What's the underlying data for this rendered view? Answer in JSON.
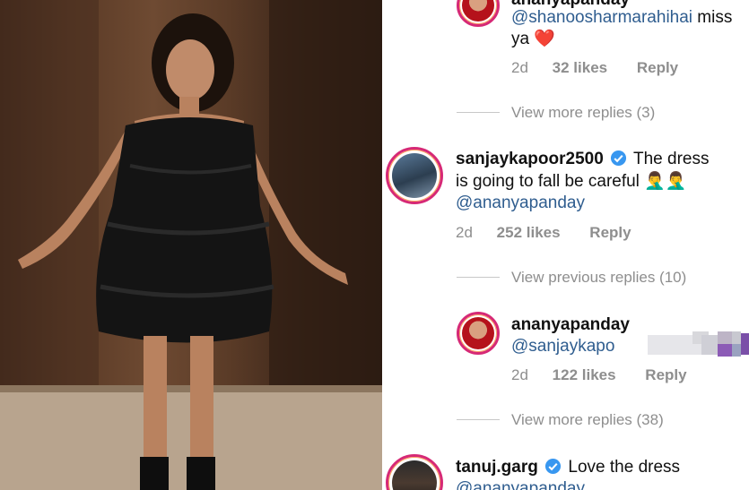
{
  "photo": {
    "alt_name": "woman-in-black-ruffle-dress-photo"
  },
  "comments": [
    {
      "username": "ananyapanday",
      "text_mention": "@shanoosharmarahihai",
      "text_rest": " miss",
      "text_line2": "ya",
      "emoji": "❤️",
      "age": "2d",
      "likes": "32 likes",
      "reply": "Reply"
    },
    {
      "username": "sanjaykapoor2500",
      "text_line1": "The dress",
      "text_line2": "is going to fall be careful",
      "emoji": "🤦‍♂️🤦‍♂️",
      "text_mention": "@ananyapanday",
      "age": "2d",
      "likes": "252 likes",
      "reply": "Reply"
    },
    {
      "username": "ananyapanday",
      "text_mention": "@sanjaykapo",
      "age": "2d",
      "likes": "122 likes",
      "reply": "Reply"
    },
    {
      "username": "tanuj.garg",
      "text_line1": "Love the dress",
      "text_mention": "@ananyapanday"
    }
  ],
  "thread_links": {
    "more_replies_1": "View more replies (3)",
    "previous_replies": "View previous replies (10)",
    "more_replies_2": "View more replies (38)"
  },
  "colors": {
    "mention": "#2f5d8f",
    "verified": "#3897f0",
    "meta": "#8e8e8e"
  }
}
